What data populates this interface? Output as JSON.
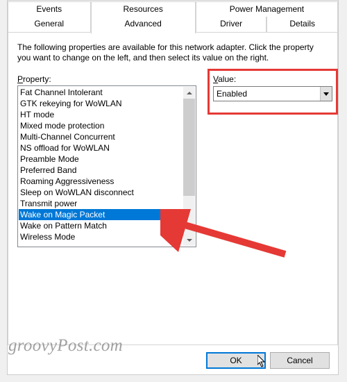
{
  "tabs": {
    "row1": [
      "Events",
      "Resources",
      "Power Management"
    ],
    "row2": [
      "General",
      "Advanced",
      "Driver",
      "Details"
    ],
    "active": "Advanced"
  },
  "description": "The following properties are available for this network adapter. Click the property you want to change on the left, and then select its value on the right.",
  "property": {
    "label": "Property:",
    "items": [
      "Fat Channel Intolerant",
      "GTK rekeying for WoWLAN",
      "HT mode",
      "Mixed mode protection",
      "Multi-Channel Concurrent",
      "NS offload for WoWLAN",
      "Preamble Mode",
      "Preferred Band",
      "Roaming Aggressiveness",
      "Sleep on WoWLAN disconnect",
      "Transmit power",
      "Wake on Magic Packet",
      "Wake on Pattern Match",
      "Wireless Mode"
    ],
    "selected_index": 11
  },
  "value": {
    "label": "Value:",
    "selected": "Enabled"
  },
  "buttons": {
    "ok": "OK",
    "cancel": "Cancel"
  },
  "watermark": "groovyPost.com"
}
